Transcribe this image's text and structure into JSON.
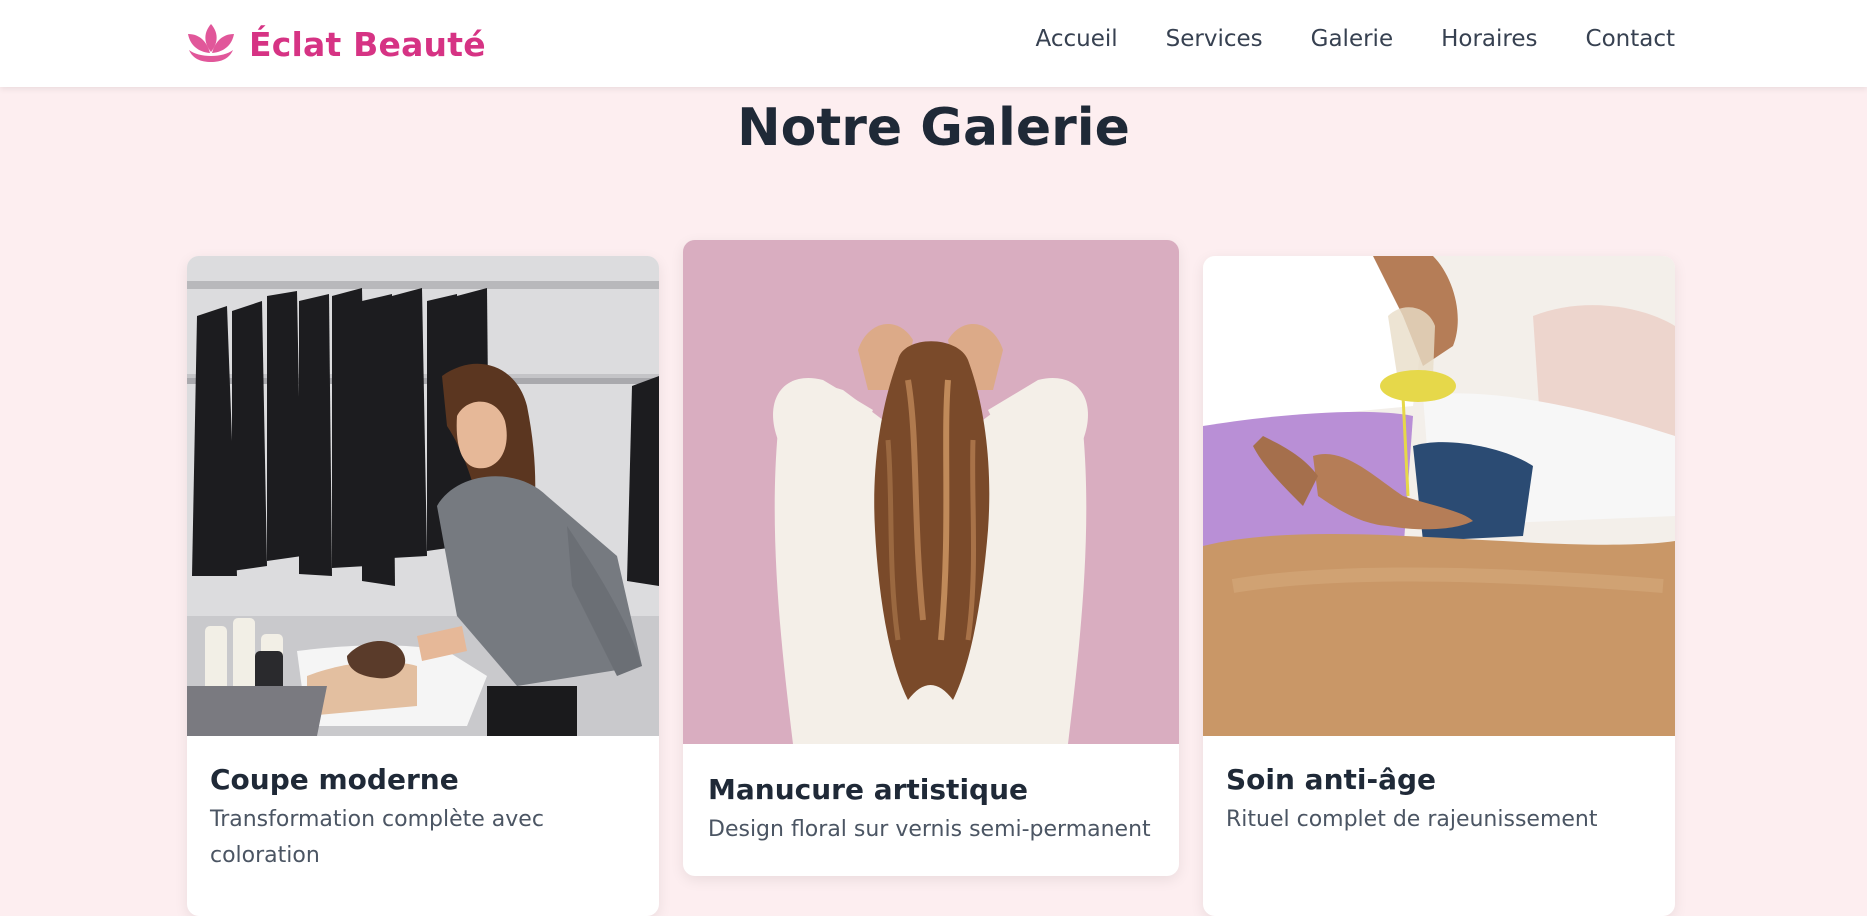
{
  "brand": {
    "name": "Éclat Beauté",
    "icon": "lotus-icon",
    "color": "#d63384"
  },
  "nav": {
    "links": [
      {
        "label": "Accueil"
      },
      {
        "label": "Services"
      },
      {
        "label": "Galerie"
      },
      {
        "label": "Horaires"
      },
      {
        "label": "Contact"
      }
    ]
  },
  "gallery": {
    "title": "Notre Galerie",
    "items": [
      {
        "title": "Coupe moderne",
        "description": "Transformation complète avec coloration",
        "image": "salon-hair-wash-photo"
      },
      {
        "title": "Manucure artistique",
        "description": "Design floral sur vernis semi-permanent",
        "image": "wavy-hair-back-view-photo"
      },
      {
        "title": "Soin anti-âge",
        "description": "Rituel complet de rajeunissement",
        "image": "massage-oil-photo"
      }
    ]
  },
  "colors": {
    "background": "#fdeef0",
    "accent": "#d63384",
    "text": "#1f2937"
  }
}
